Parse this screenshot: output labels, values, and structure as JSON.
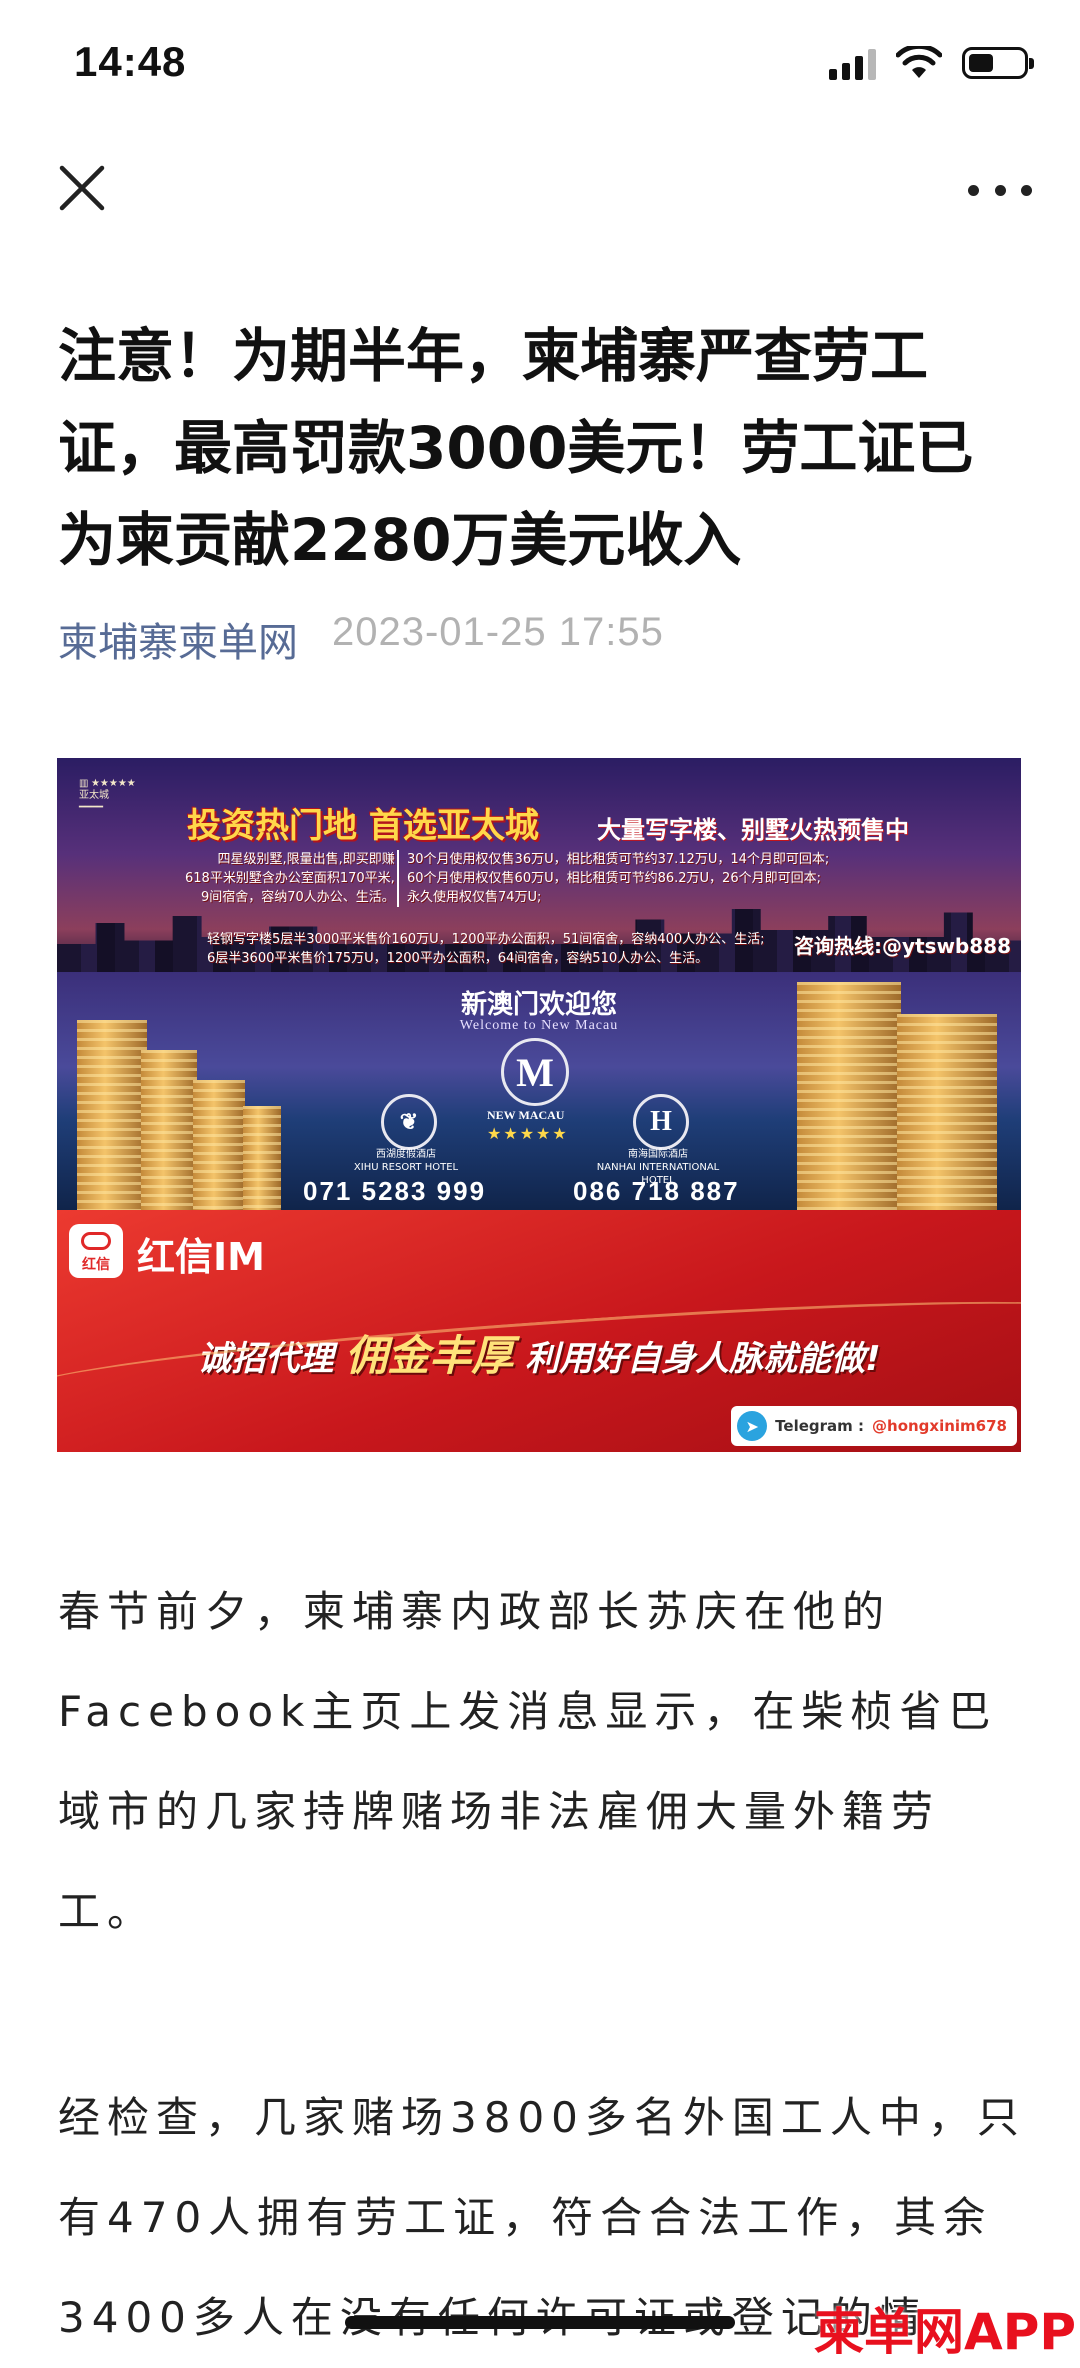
{
  "status_bar": {
    "time": "14:48",
    "icons": [
      "cellular-signal-icon",
      "wifi-icon",
      "battery-icon"
    ],
    "battery_level": 0.45
  },
  "nav": {
    "close_icon": "close-icon",
    "more_icon": "more-icon"
  },
  "article": {
    "title": "注意！为期半年，柬埔寨严查劳工证，最高罚款3000美元！劳工证已为柬贡献2280万美元收入",
    "source": "柬埔寨柬单网",
    "date": "2023-01-25 17:55",
    "paragraphs": [
      "春节前夕，柬埔寨内政部长苏庆在他的Facebook主页上发消息显示，在柴桢省巴域市的几家持牌赌场非法雇佣大量外籍劳工。",
      "经检查，几家赌场3800多名外国工人中，只有470人拥有劳工证，符合合法工作，其余3400多人在没有任何许可证或登记的情"
    ]
  },
  "banner": {
    "headline": "投资热门地 首选亚太城",
    "subhead": "大量写字楼、别墅火热预售中",
    "detail_left": [
      "四星级别墅,限量出售,即买即赚",
      "618平米别墅含办公室面积170平米,",
      "9间宿舍，容纳70人办公、生活。"
    ],
    "detail_right": [
      "30个月使用权仅售36万U，相比租赁可节约37.12万U，14个月即可回本;",
      "60个月使用权仅售60万U，相比租赁可节约86.2万U，26个月即可回本;",
      "永久使用权仅售74万U;"
    ],
    "detail_bottom": [
      "轻钢写字楼5层半3000平米售价160万U，1200平办公面积，51间宿舍，容纳400人办公、生活;",
      "6层半3600平米售价175万U，1200平办公面积，64间宿舍，容纳510人办公、生活。"
    ],
    "hotline": "咨询热线:@ytswb888",
    "welcome_cn": "新澳门欢迎您",
    "welcome_en": "Welcome to New Macau",
    "brand": "NEW MACAU",
    "stars": "★★★★★",
    "hotel_left_name": "西湖度假酒店",
    "hotel_left_en": "XIHU RESORT HOTEL",
    "hotel_left_phone": "071 5283 999",
    "hotel_right_name": "南海国际酒店",
    "hotel_right_en": "NANHAI INTERNATIONAL HOTEL",
    "hotel_right_phone": "086 718 887",
    "app_icon_text": "红信",
    "app_name": "红信IM",
    "slogan_a": "诚招代理",
    "slogan_hl": "佣金丰厚",
    "slogan_b": "利用好自身人脉就能做!",
    "telegram_label": "Telegram :",
    "telegram_handle": "@hongxinim678"
  },
  "watermark": {
    "text": "柬单网APP"
  }
}
